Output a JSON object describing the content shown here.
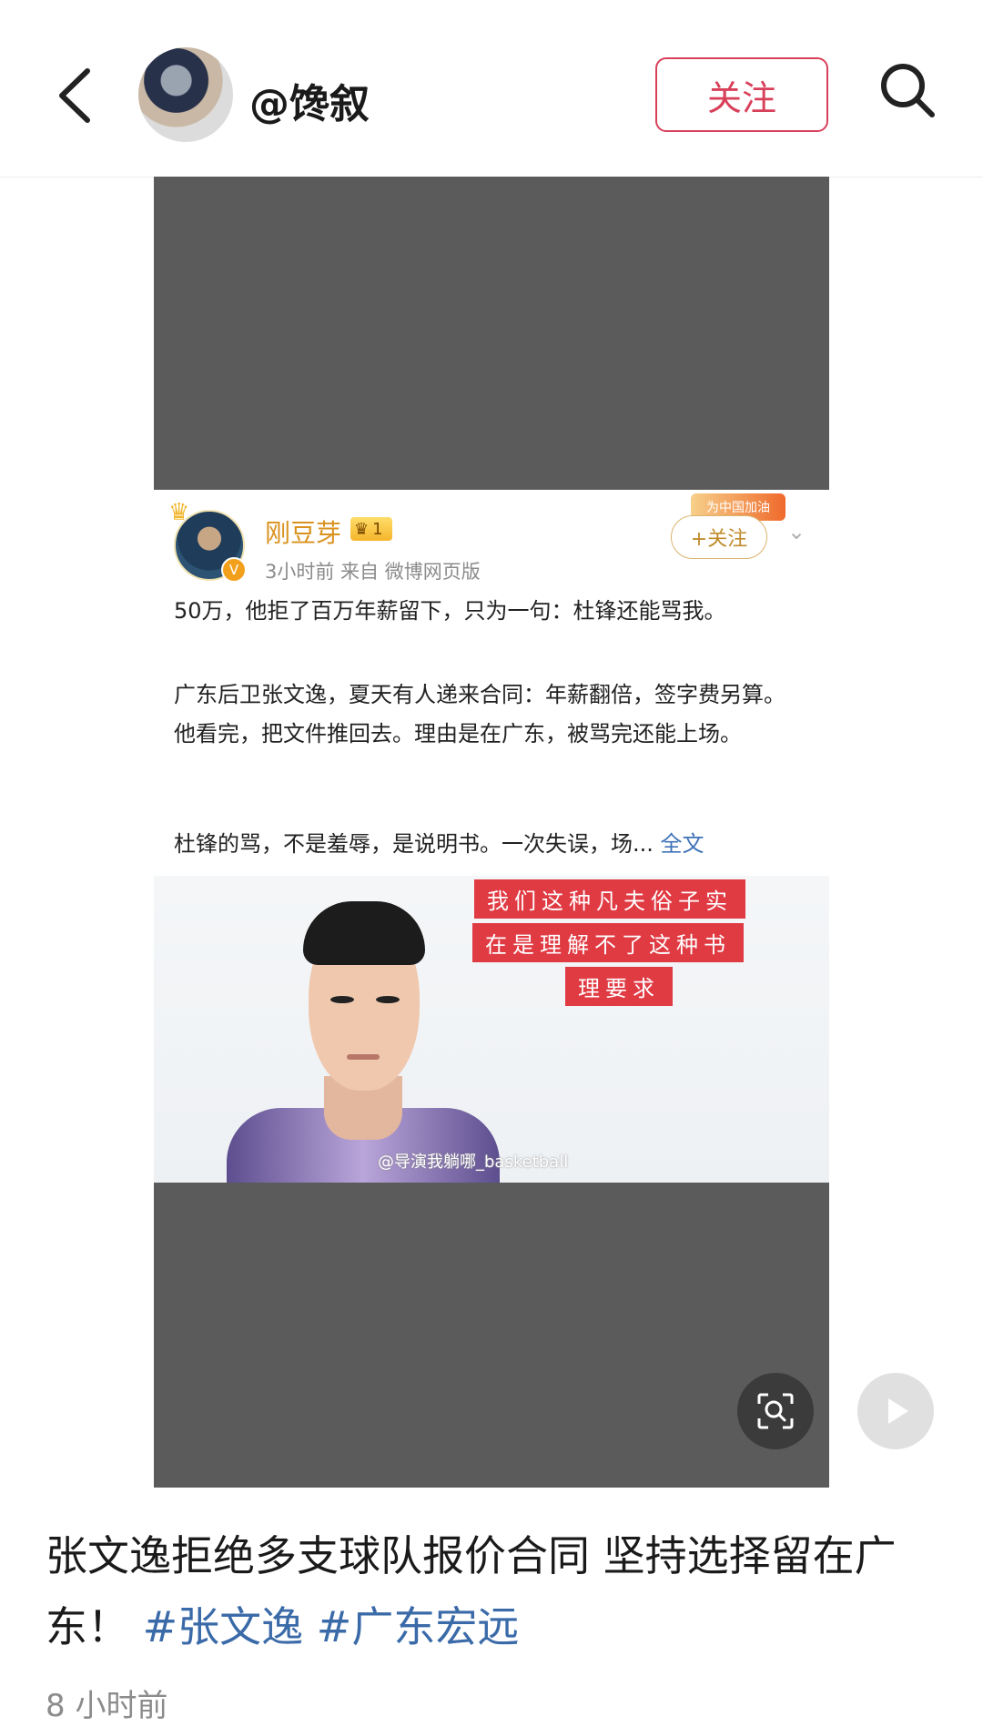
{
  "header": {
    "back_icon": "chevron-left-icon",
    "username": "@馋叙",
    "follow_label": "关注",
    "search_icon": "search-icon"
  },
  "embedded_post": {
    "author": "刚豆芽",
    "level_badge": "1",
    "meta": "3小时前  来自 微博网页版",
    "follow_label": "+关注",
    "promo_badge": "为中国加油",
    "paragraph1": "50万，他拒了百万年薪留下，只为一句：杜锋还能骂我。",
    "paragraph2": "广东后卫张文逸，夏天有人递来合同：年薪翻倍，签字费另算。他看完，把文件推回去。理由是在广东，被骂完还能上场。",
    "paragraph3": "杜锋的骂，不是羞辱，是说明书。一次失误，场...",
    "fulltext_link": "全文",
    "caption_line1": "我们这种凡夫俗子实",
    "caption_line2": "在是理解不了这种书",
    "caption_line3": "理要求",
    "watermark": "@导演我躺哪_basketball"
  },
  "overlay_buttons": {
    "scan_icon": "scan-search-icon",
    "play_icon": "play-icon"
  },
  "post": {
    "title_text": "张文逸拒绝多支球队报价合同 坚持选择留在广东！",
    "hashtag1": "#张文逸",
    "hashtag2": "#广东宏远",
    "time": "8 小时前"
  }
}
